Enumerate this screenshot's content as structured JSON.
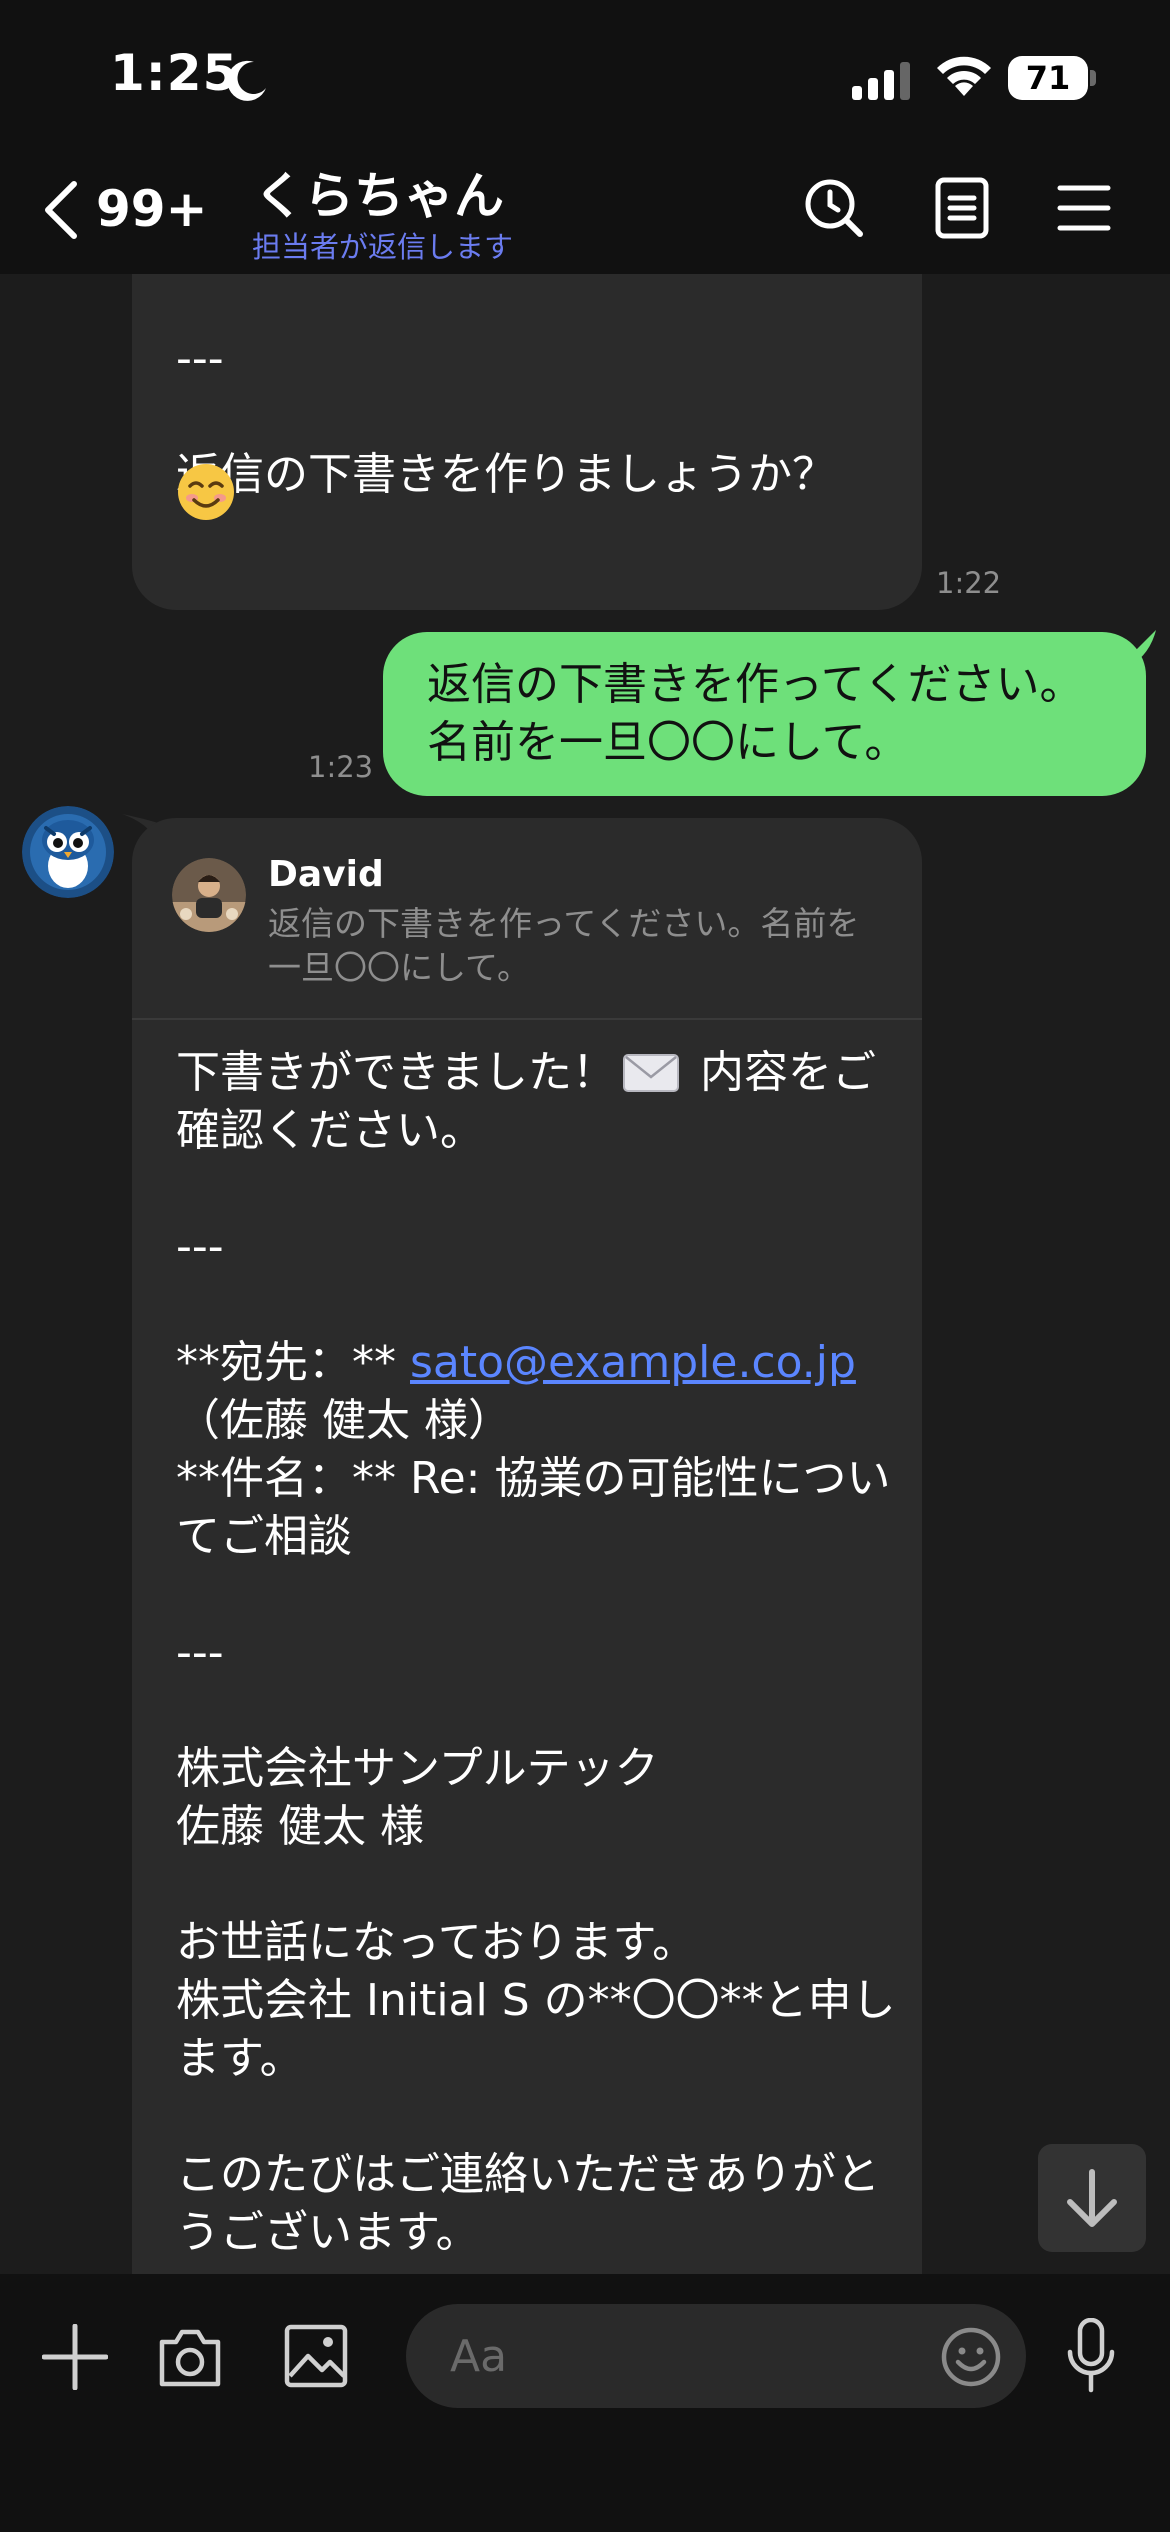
{
  "status_bar": {
    "time": "1:25",
    "battery": "71"
  },
  "header": {
    "back_count": "99+",
    "title": "くらちゃん",
    "subtitle": "担当者が返信します"
  },
  "messages": {
    "m1": {
      "text": "の相談\n\n---\n\n返信の下書きを作りましょうか？",
      "emoji": "smiling-face-emoji",
      "time": "1:22"
    },
    "m2": {
      "text": "返信の下書きを作ってください。\n名前を一旦〇〇にして。",
      "time": "1:23"
    },
    "m3": {
      "reply_name": "David",
      "reply_text": "返信の下書きを作ってください。名前を一旦〇〇にして。",
      "line1a": "下書きができました！",
      "line1b": " 内容をご確認ください。",
      "sep1": "---",
      "to_label": "**宛先：** ",
      "to_email": "sato@example.co.jp",
      "to_name": "（佐藤 健太 様）",
      "subject": "**件名：** Re: 協業の可能性についてご相談",
      "sep2": "---",
      "company": "株式会社サンプルテック\n佐藤 健太 様",
      "greeting": "お世話になっております。\n株式会社 Initial S の**〇〇**と申します。",
      "thanks": "このたびはご連絡いただきありがとうございます。"
    }
  },
  "input": {
    "placeholder": "Aa"
  },
  "colors": {
    "outgoing_bubble": "#6ee07a",
    "incoming_bubble": "#2b2b2b",
    "link": "#5b86ff",
    "subtitle": "#6b7cf0"
  }
}
